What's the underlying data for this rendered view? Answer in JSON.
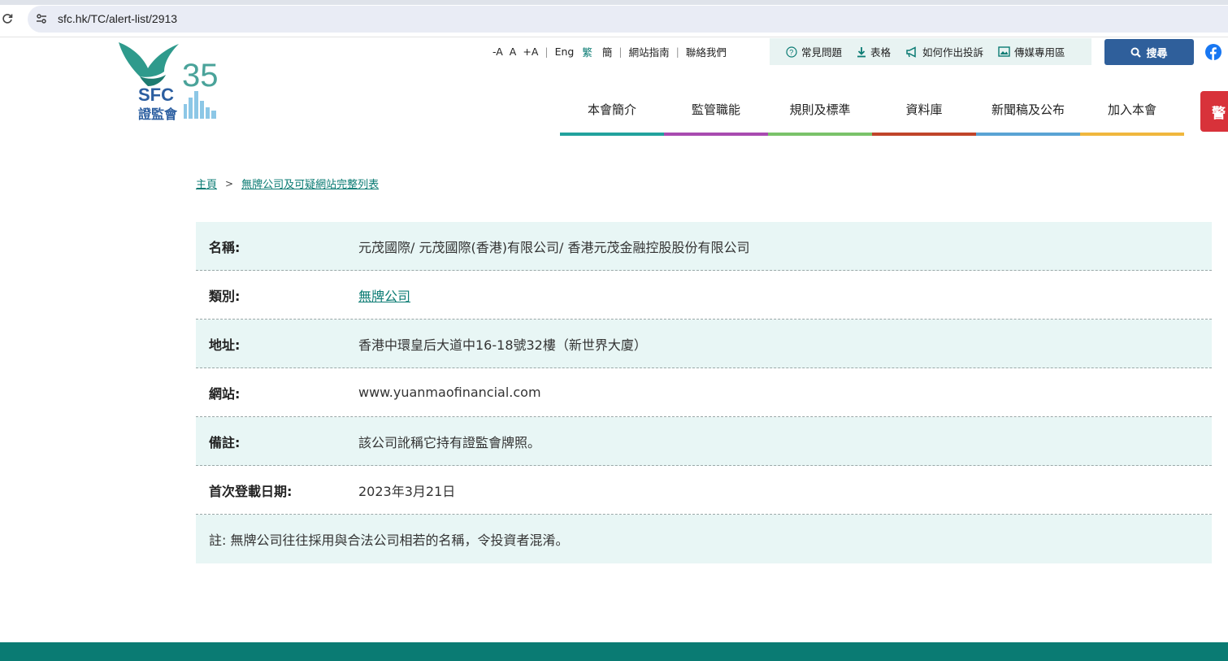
{
  "browser": {
    "url": "sfc.hk/TC/alert-list/2913"
  },
  "header": {
    "logo": {
      "number": "35",
      "abbr": "SFC",
      "chinese": "證監會"
    },
    "font_size": [
      "-A",
      "A",
      "+A"
    ],
    "languages": [
      "Eng",
      "繁",
      "簡"
    ],
    "site_guide": "網站指南",
    "contact": "聯絡我們",
    "quick_links": {
      "faq": "常見問題",
      "forms": "表格",
      "complaint": "如何作出投訴",
      "media": "傳媒專用區"
    },
    "search_label": "搜尋",
    "nav": [
      {
        "label": "本會簡介",
        "color": "#21a29d"
      },
      {
        "label": "監管職能",
        "color": "#a84bb0"
      },
      {
        "label": "規則及標準",
        "color": "#7ac36a"
      },
      {
        "label": "資料庫",
        "color": "#c0442a"
      },
      {
        "label": "新聞稿及公布",
        "color": "#5aa3d4"
      },
      {
        "label": "加入本會",
        "color": "#f0b73d"
      }
    ],
    "alert_tab": "警"
  },
  "breadcrumb": {
    "home": "主頁",
    "separator": ">",
    "current": "無牌公司及可疑網站完整列表"
  },
  "details": {
    "name_label": "名稱:",
    "name_value": "元茂國際/ 元茂國際(香港)有限公司/ 香港元茂金融控股股份有限公司",
    "category_label": "類別:",
    "category_value": "無牌公司",
    "address_label": "地址:",
    "address_value": "香港中環皇后大道中16-18號32樓（新世界大廈）",
    "website_label": "網站:",
    "website_value": "www.yuanmaofinancial.com",
    "remarks_label": "備註:",
    "remarks_value": "該公司訛稱它持有證監會牌照。",
    "date_label": "首次登載日期:",
    "date_value": "2023年3月21日",
    "note": "註: 無牌公司往往採用與合法公司相若的名稱，令投資者混淆。"
  },
  "colors": {
    "brand_teal": "#0a7b73",
    "search_blue": "#2f5f9b",
    "alert_red": "#d8323a",
    "row_shade": "#e8f6f5"
  }
}
